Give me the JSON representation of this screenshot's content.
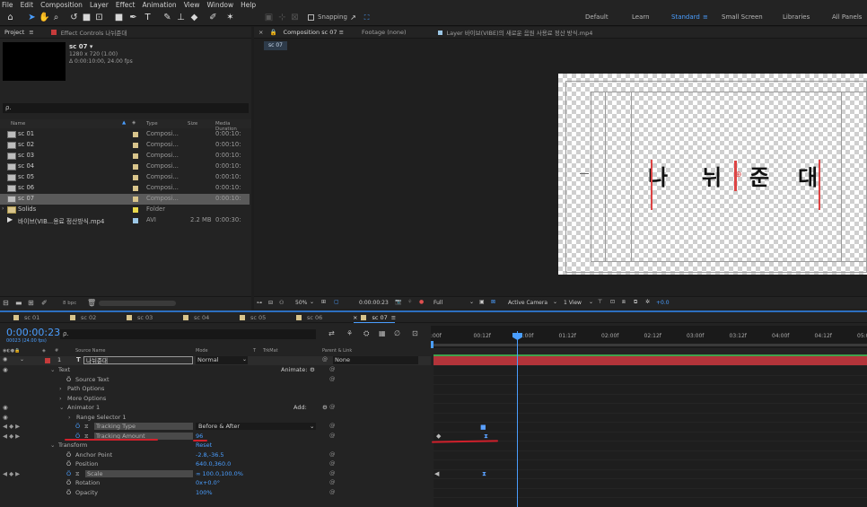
{
  "menu": [
    "File",
    "Edit",
    "Composition",
    "Layer",
    "Effect",
    "Animation",
    "View",
    "Window",
    "Help"
  ],
  "toolbar": {
    "snapping_label": "Snapping",
    "workspaces": [
      "Default",
      "Learn",
      "Standard",
      "Small Screen",
      "Libraries",
      "All Panels"
    ],
    "active_workspace": "Standard"
  },
  "project_panel": {
    "tabs": [
      "Project",
      "Effect Controls 나뉘준대"
    ],
    "comp_name": "sc 07 ▾",
    "comp_info1": "1280 x 720 (1.00)",
    "comp_info2": "Δ 0:00:10:00, 24.00 fps",
    "search_placeholder": "ρ.",
    "columns": [
      "Name",
      "Type",
      "Size",
      "Media Duration"
    ],
    "items": [
      {
        "name": "sc 01",
        "type": "Composi...",
        "size": "",
        "duration": "0:00:10:"
      },
      {
        "name": "sc 02",
        "type": "Composi...",
        "size": "",
        "duration": "0:00:10:"
      },
      {
        "name": "sc 03",
        "type": "Composi...",
        "size": "",
        "duration": "0:00:10:"
      },
      {
        "name": "sc 04",
        "type": "Composi...",
        "size": "",
        "duration": "0:00:10:"
      },
      {
        "name": "sc 05",
        "type": "Composi...",
        "size": "",
        "duration": "0:00:10:"
      },
      {
        "name": "sc 06",
        "type": "Composi...",
        "size": "",
        "duration": "0:00:10:"
      },
      {
        "name": "sc 07",
        "type": "Composi...",
        "size": "",
        "duration": "0:00:10:"
      },
      {
        "name": "Solids",
        "type": "Folder",
        "size": "",
        "duration": ""
      },
      {
        "name": "바이브(VIB...용료 정산방식.mp4",
        "type": "AVI",
        "size": "2.2 MB",
        "duration": "0:00:30:"
      }
    ],
    "bpc": "8 bpc"
  },
  "comp_panel": {
    "tabs": [
      "Composition sc 07 ≡",
      "Footage (none)",
      "Layer 바이브(VIBE)의 새로운 음원 사용료 정산 방식.mp4"
    ],
    "subtab": "sc 07",
    "canvas_text": [
      "나",
      "뉘",
      "준",
      "대"
    ],
    "zoom": "50%",
    "timecode": "0:00:00:23",
    "resolution": "Full",
    "camera": "Active Camera",
    "view": "1 View",
    "exposure": "+0.0"
  },
  "timeline": {
    "comp_tabs": [
      "sc 01",
      "sc 02",
      "sc 03",
      "sc 04",
      "sc 05",
      "sc 06",
      "sc 07"
    ],
    "active_tab": "sc 07",
    "timecode": "0:00:00:23",
    "timecode_sub": "00023 (24.00 fps)",
    "search_placeholder": "ρ.",
    "header": {
      "source_name": "Source Name",
      "mode": "Mode",
      "t": "T",
      "trkmat": "TrkMat",
      "parent": "Parent & Link"
    },
    "layer": {
      "index": "1",
      "name": "나뉘준대",
      "mode": "Normal",
      "parent": "None"
    },
    "ruler": [
      ":00f",
      "00:12f",
      "01:00f",
      "01:12f",
      "02:00f",
      "02:12f",
      "03:00f",
      "03:12f",
      "04:00f",
      "04:12f",
      "05:0"
    ],
    "props": [
      {
        "label": "Text",
        "indent": 1,
        "extra": "Animate:"
      },
      {
        "label": "Source Text",
        "indent": 2
      },
      {
        "label": "Path Options",
        "indent": 2
      },
      {
        "label": "More Options",
        "indent": 2
      },
      {
        "label": "Animator 1",
        "indent": 2,
        "extra": "Add:"
      },
      {
        "label": "Range Selector 1",
        "indent": 3
      },
      {
        "label": "Tracking Type",
        "indent": 3,
        "value": "Before & After"
      },
      {
        "label": "Tracking Amount",
        "indent": 3,
        "value": "96"
      },
      {
        "label": "Transform",
        "indent": 1,
        "extra": "Reset"
      },
      {
        "label": "Anchor Point",
        "indent": 2,
        "value": "-2.8,-36.5"
      },
      {
        "label": "Position",
        "indent": 2,
        "value": "640.0,360.0"
      },
      {
        "label": "Scale",
        "indent": 2,
        "value": "∞ 100.0,100.0%"
      },
      {
        "label": "Rotation",
        "indent": 2,
        "value": "0x+0.0°"
      },
      {
        "label": "Opacity",
        "indent": 2,
        "value": "100%"
      }
    ]
  },
  "colors": {
    "accent": "#4a9eff",
    "layer_bar": "#b3343a",
    "label_red": "#c63b3b",
    "annotation": "#d0202b"
  }
}
